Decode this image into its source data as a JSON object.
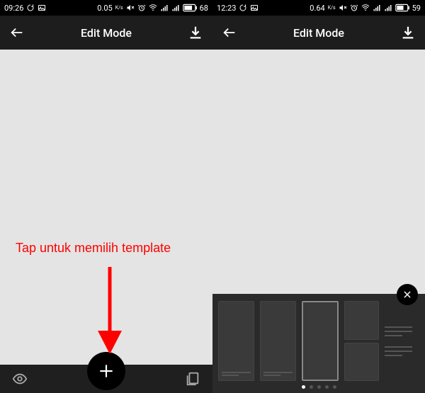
{
  "annotation": {
    "label": "Tap untuk memilih template",
    "color": "#FF0000"
  },
  "screens": [
    {
      "status": {
        "time": "09:26",
        "net_speed": "0.05",
        "net_unit": "K/s",
        "battery_text": "68"
      },
      "app_bar": {
        "title": "Edit Mode"
      },
      "template_panel_visible": false
    },
    {
      "status": {
        "time": "12:23",
        "net_speed": "0.64",
        "net_unit": "K/s",
        "battery_text": "59"
      },
      "app_bar": {
        "title": "Edit Mode"
      },
      "template_panel_visible": true,
      "pagination": {
        "count": 5,
        "active": 0
      }
    }
  ]
}
